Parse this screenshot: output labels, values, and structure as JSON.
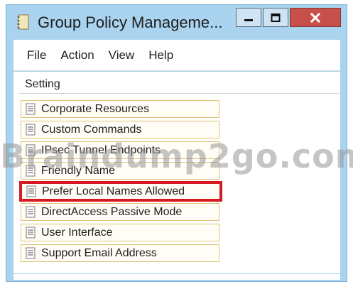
{
  "window": {
    "title": "Group Policy Manageme...",
    "app_icon": "notebook-icon",
    "controls": {
      "minimize_icon": "minimize-icon",
      "maximize_icon": "maximize-icon",
      "close_icon": "close-icon",
      "close_color": "#c7504a"
    }
  },
  "menubar": {
    "items": [
      "File",
      "Action",
      "View",
      "Help"
    ]
  },
  "list": {
    "column_header": "Setting",
    "item_icon": "policy-setting-icon",
    "items": [
      {
        "label": "Corporate Resources",
        "highlighted": false
      },
      {
        "label": "Custom Commands",
        "highlighted": false
      },
      {
        "label": "IPsec Tunnel Endpoints",
        "highlighted": false
      },
      {
        "label": "Friendly Name",
        "highlighted": false
      },
      {
        "label": "Prefer Local Names Allowed",
        "highlighted": true
      },
      {
        "label": "DirectAccess Passive Mode",
        "highlighted": false
      },
      {
        "label": "User Interface",
        "highlighted": false
      },
      {
        "label": "Support Email Address",
        "highlighted": false
      }
    ],
    "highlight_color": "#d71920"
  },
  "watermark": "Braindump2go.com"
}
